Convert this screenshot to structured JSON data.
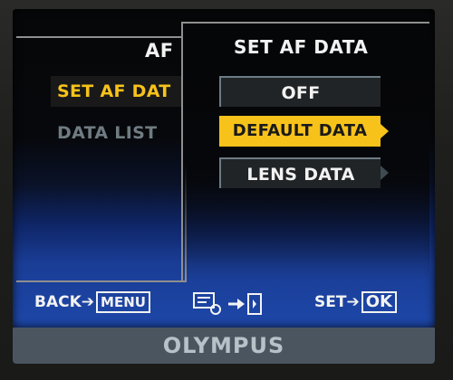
{
  "left_panel": {
    "title": "AF",
    "items": [
      {
        "label": "SET AF DAT",
        "selected": true,
        "color": "#f7c21a"
      },
      {
        "label": "DATA LIST",
        "selected": false,
        "color": "#6f7c82"
      }
    ]
  },
  "right_panel": {
    "title": "SET AF DATA",
    "options": [
      {
        "label": "OFF",
        "selected": false
      },
      {
        "label": "DEFAULT DATA",
        "selected": true
      },
      {
        "label": "LENS DATA",
        "selected": false
      }
    ]
  },
  "footer": {
    "back_label": "BACK",
    "back_key": "MENU",
    "mid_icon": "af-data-settings-icon",
    "set_label": "SET",
    "set_key": "OK"
  },
  "brand": "OLYMPUS",
  "colors": {
    "highlight": "#f7c21a",
    "screen_blue": "#1d47a8"
  }
}
